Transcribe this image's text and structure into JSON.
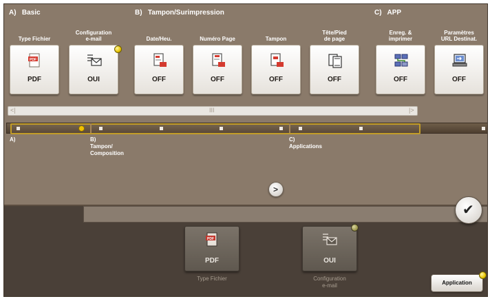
{
  "sections": [
    {
      "label": "A)   Basic"
    },
    {
      "label": "B)   Tampon/Surimpression"
    },
    {
      "label": "C)   APP"
    }
  ],
  "tiles": [
    {
      "title": "Type Fichier",
      "value": "PDF",
      "icon": "pdf-file-icon"
    },
    {
      "title": "Configuration\ne-mail",
      "value": "OUI",
      "icon": "email-config-icon"
    },
    {
      "title": "Date/Heu.",
      "value": "OFF",
      "icon": "date-stamp-icon"
    },
    {
      "title": "Numéro Page",
      "value": "OFF",
      "icon": "page-number-icon"
    },
    {
      "title": "Tampon",
      "value": "OFF",
      "icon": "stamp-icon"
    },
    {
      "title": "Tête/Pied\nde page",
      "value": "OFF",
      "icon": "header-footer-icon"
    },
    {
      "title": "Enreg. &\nimprimer",
      "value": "OFF",
      "icon": "save-print-icon"
    },
    {
      "title": "Paramètres\nURL Destinat.",
      "value": "OFF",
      "icon": "url-destination-icon"
    }
  ],
  "scrollbar": {
    "left": "<|",
    "middle": "III",
    "right": "|>"
  },
  "nav": [
    {
      "label": "A)"
    },
    {
      "label": "B)\nTampon/\nComposition"
    },
    {
      "label": "C)\nApplications"
    }
  ],
  "next_label": ">",
  "ok_label": "✔",
  "selected": [
    {
      "value": "PDF",
      "caption": "Type Fichier",
      "icon": "pdf-file-icon"
    },
    {
      "value": "OUI",
      "caption": "Configuration\ne-mail",
      "icon": "email-config-icon"
    }
  ],
  "application_button": "Application",
  "colors": {
    "accent": "#c39d28",
    "notification": "#f0c000",
    "background": "#8a7a6a"
  }
}
